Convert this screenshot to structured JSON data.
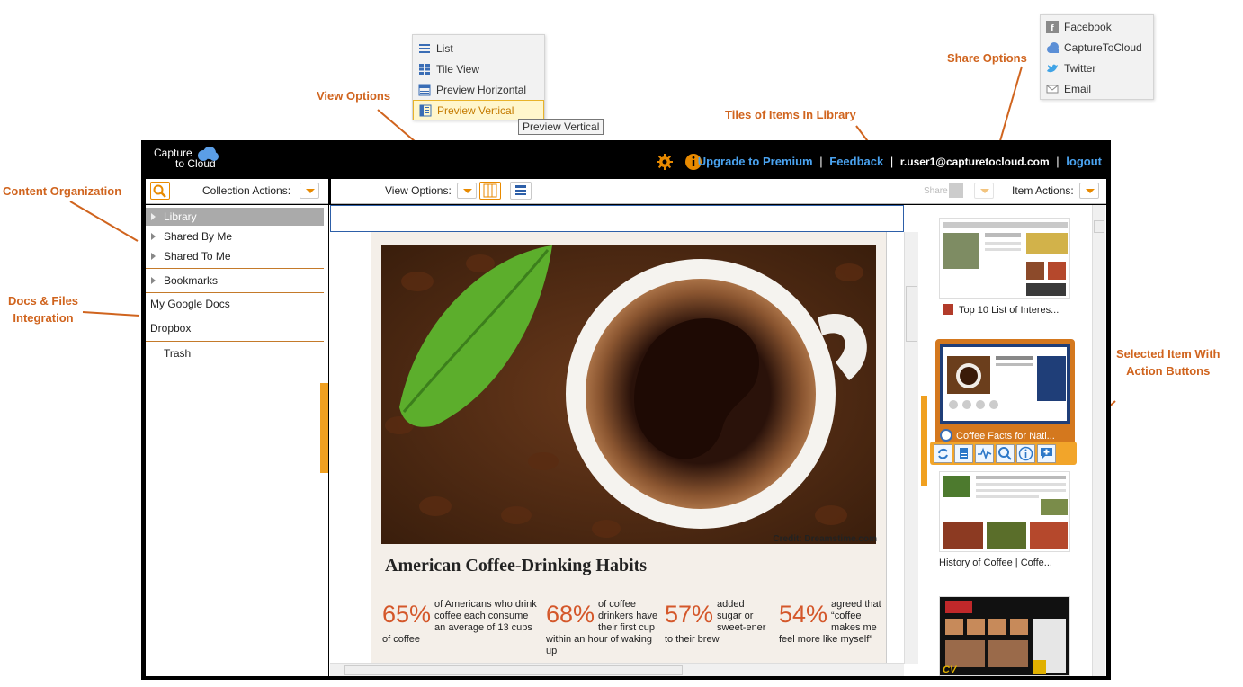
{
  "annotations": {
    "content_organization": "Content Organization",
    "docs_files_line1": "Docs & Files",
    "docs_files_line2": "Integration",
    "view_options": "View Options",
    "tiles_of_items": "Tiles of Items In Library",
    "share_options": "Share Options",
    "selected_item_line1": "Selected Item With",
    "selected_item_line2": "Action Buttons"
  },
  "view_menu": {
    "items": [
      {
        "label": "List",
        "icon": "list-icon"
      },
      {
        "label": "Tile View",
        "icon": "tile-view-icon"
      },
      {
        "label": "Preview Horizontal",
        "icon": "preview-horizontal-icon"
      },
      {
        "label": "Preview Vertical",
        "icon": "preview-vertical-icon"
      }
    ],
    "tooltip": "Preview Vertical"
  },
  "share_menu": {
    "items": [
      {
        "label": "Facebook",
        "icon": "facebook-icon"
      },
      {
        "label": "CaptureToCloud",
        "icon": "cloud-icon"
      },
      {
        "label": "Twitter",
        "icon": "twitter-icon"
      },
      {
        "label": "Email",
        "icon": "email-icon"
      }
    ]
  },
  "header": {
    "logo_line1": "Capture",
    "logo_line2": "to Cloud",
    "upgrade": "Upgrade to Premium",
    "feedback": "Feedback",
    "user": "r.user1@capturetocloud.com",
    "logout": "logout",
    "sep": "|"
  },
  "toolbar": {
    "collection_actions": "Collection Actions:",
    "view_options": "View Options:",
    "share": "Share",
    "item_actions": "Item Actions:"
  },
  "sidebar": {
    "items": [
      {
        "label": "Library"
      },
      {
        "label": "Shared By Me"
      },
      {
        "label": "Shared To Me"
      },
      {
        "label": "Bookmarks"
      },
      {
        "label": "My Google Docs"
      },
      {
        "label": "Dropbox"
      },
      {
        "label": "Trash"
      }
    ]
  },
  "preview": {
    "credit": "Credit: Dreamstime.com",
    "heading": "American Coffee-Drinking Habits",
    "stats": [
      {
        "value": "65%",
        "text": "of Americans who drink coffee each consume an average of 13 cups of coffee"
      },
      {
        "value": "68%",
        "text": "of coffee drinkers have their first cup within an hour of waking up"
      },
      {
        "value": "57%",
        "text": "added sugar or sweet-ener to their brew"
      },
      {
        "value": "54%",
        "text": "agreed that “coffee makes me feel more like myself”"
      }
    ]
  },
  "tiles": [
    {
      "caption": "Top 10 List of Interes..."
    },
    {
      "caption": "Coffee Facts for Nati..."
    },
    {
      "caption": "History of Coffee | Coffe..."
    },
    {
      "caption": "CV"
    }
  ],
  "colors": {
    "accent": "#e88a00",
    "annotation": "#d0641e",
    "link": "#4aa3f0",
    "stat": "#d4572a"
  }
}
